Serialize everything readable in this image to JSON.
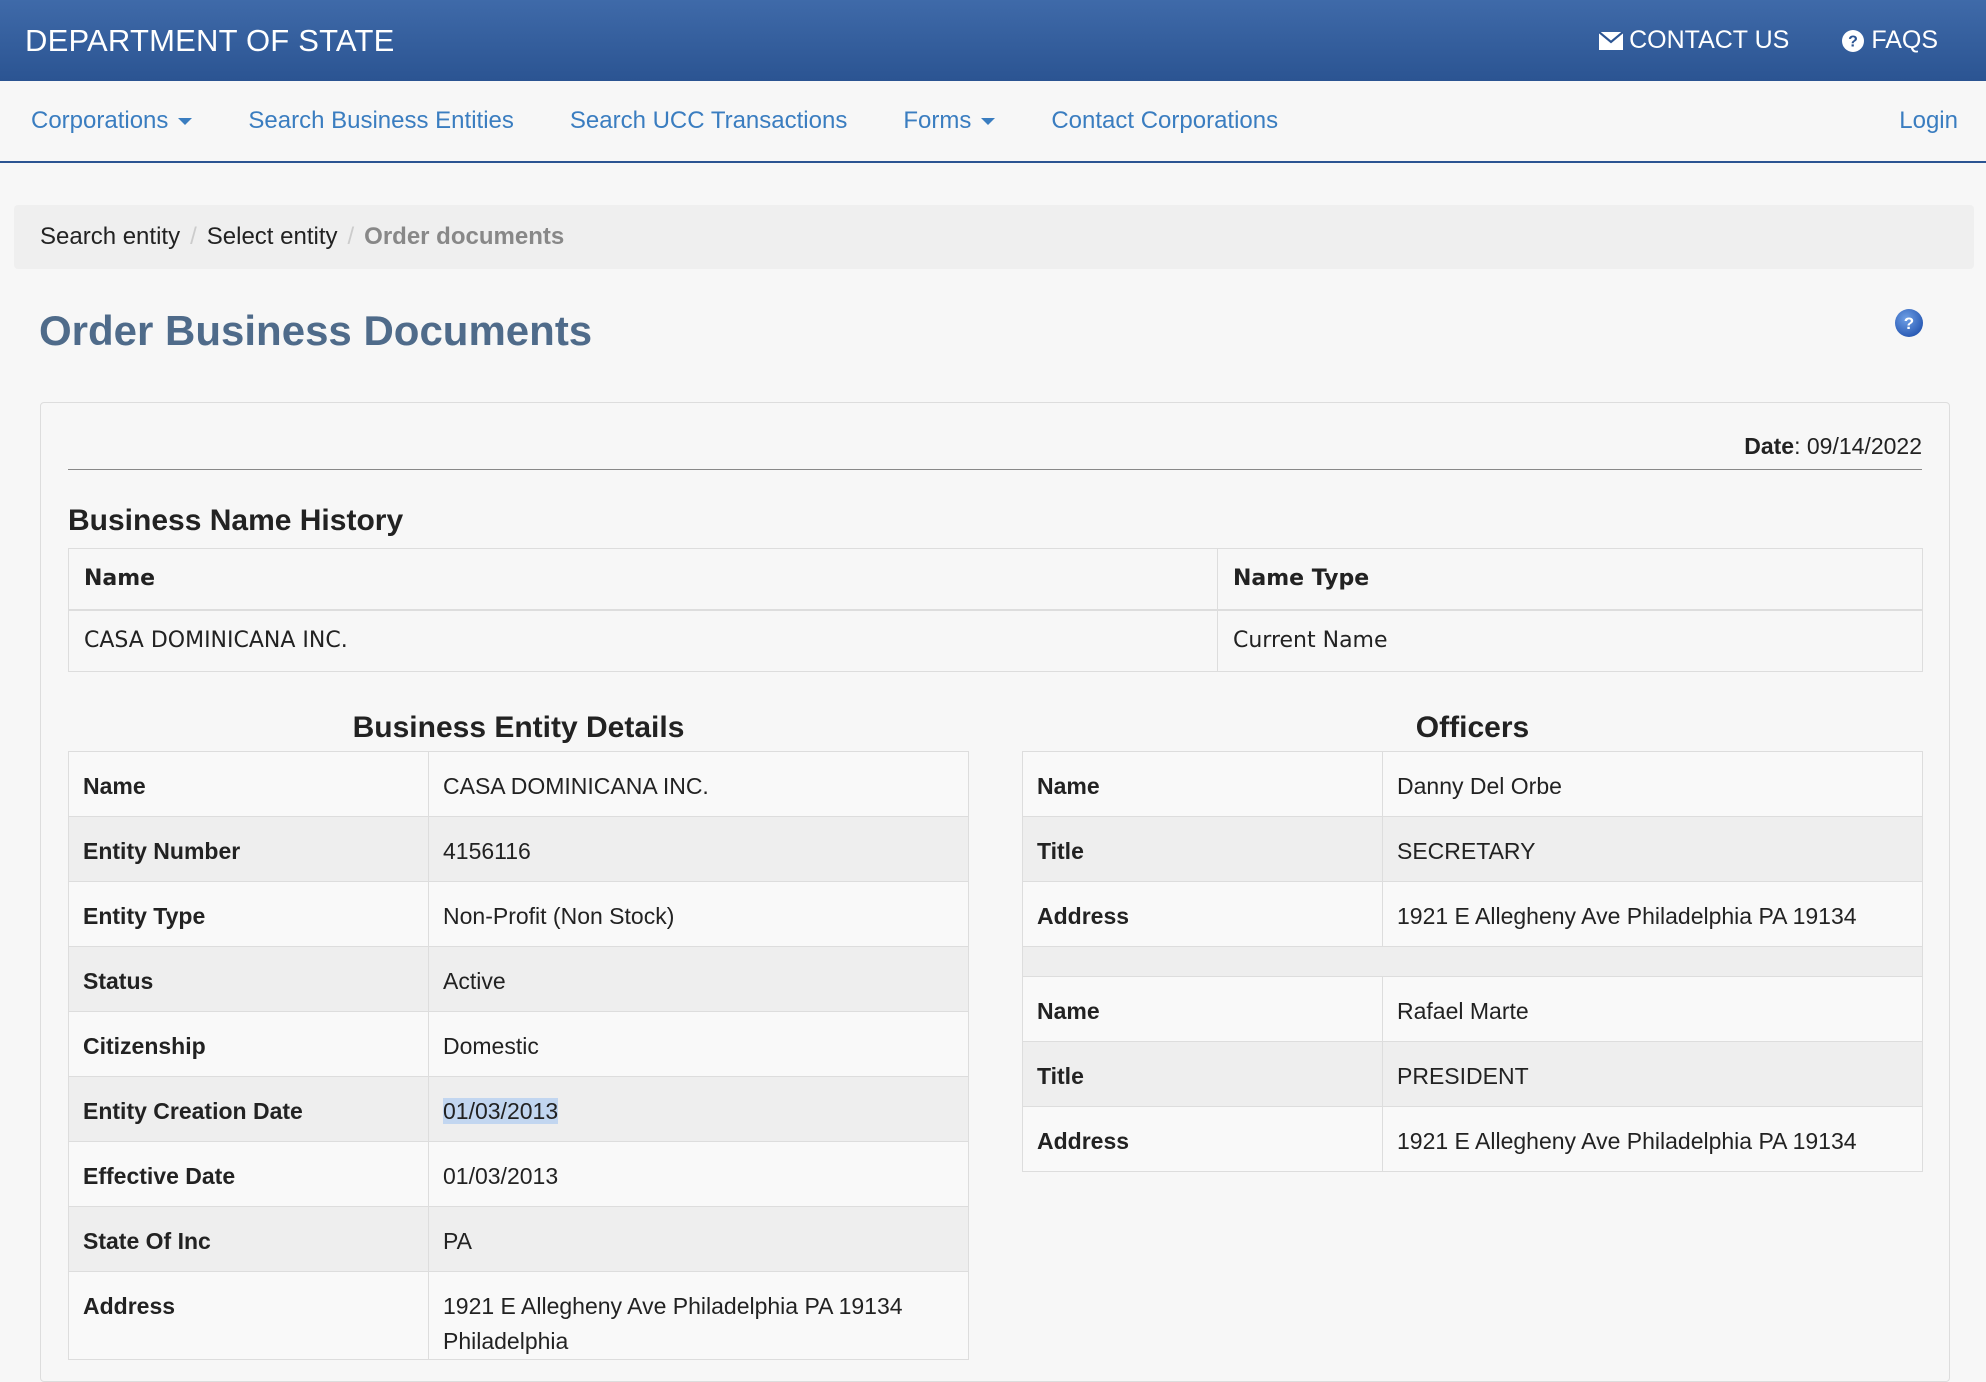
{
  "header": {
    "brand": "DEPARTMENT OF STATE",
    "contact_label": "CONTACT US",
    "faqs_label": "FAQS"
  },
  "nav": {
    "corporations": "Corporations",
    "search_entities": "Search Business Entities",
    "search_ucc": "Search UCC Transactions",
    "forms": "Forms",
    "contact_corporations": "Contact Corporations",
    "login": "Login"
  },
  "breadcrumb": [
    "Search entity",
    "Select entity",
    "Order documents"
  ],
  "page_title": "Order Business Documents",
  "date": {
    "label": "Date",
    "value": "09/14/2022"
  },
  "name_history": {
    "title": "Business Name History",
    "columns": [
      "Name",
      "Name Type"
    ],
    "rows": [
      [
        "CASA DOMINICANA INC.",
        "Current Name"
      ]
    ]
  },
  "details": {
    "title": "Business Entity Details",
    "rows": [
      [
        "Name",
        "CASA DOMINICANA INC."
      ],
      [
        "Entity Number",
        "4156116"
      ],
      [
        "Entity Type",
        "Non-Profit (Non Stock)"
      ],
      [
        "Status",
        "Active"
      ],
      [
        "Citizenship",
        "Domestic"
      ],
      [
        "Entity Creation Date",
        "01/03/2013"
      ],
      [
        "Effective Date",
        "01/03/2013"
      ],
      [
        "State Of Inc",
        "PA"
      ],
      [
        "Address",
        "1921 E Allegheny Ave Philadelphia PA 19134"
      ]
    ],
    "address_line2": "Philadelphia"
  },
  "officers": {
    "title": "Officers",
    "list": [
      {
        "name_label": "Name",
        "name": "Danny Del Orbe",
        "title_label": "Title",
        "title": "SECRETARY",
        "address_label": "Address",
        "address": "1921 E Allegheny Ave Philadelphia PA 19134"
      },
      {
        "name_label": "Name",
        "name": "Rafael Marte",
        "title_label": "Title",
        "title": "PRESIDENT",
        "address_label": "Address",
        "address": "1921 E Allegheny Ave Philadelphia PA 19134"
      }
    ]
  },
  "colors": {
    "banner": "#2b5492",
    "link": "#3a7dc0",
    "title": "#4f6b8a",
    "highlight": "#c2d6f0"
  },
  "icons": {
    "contact": "envelope-icon",
    "faqs": "question-circle-icon",
    "help": "help-icon"
  }
}
